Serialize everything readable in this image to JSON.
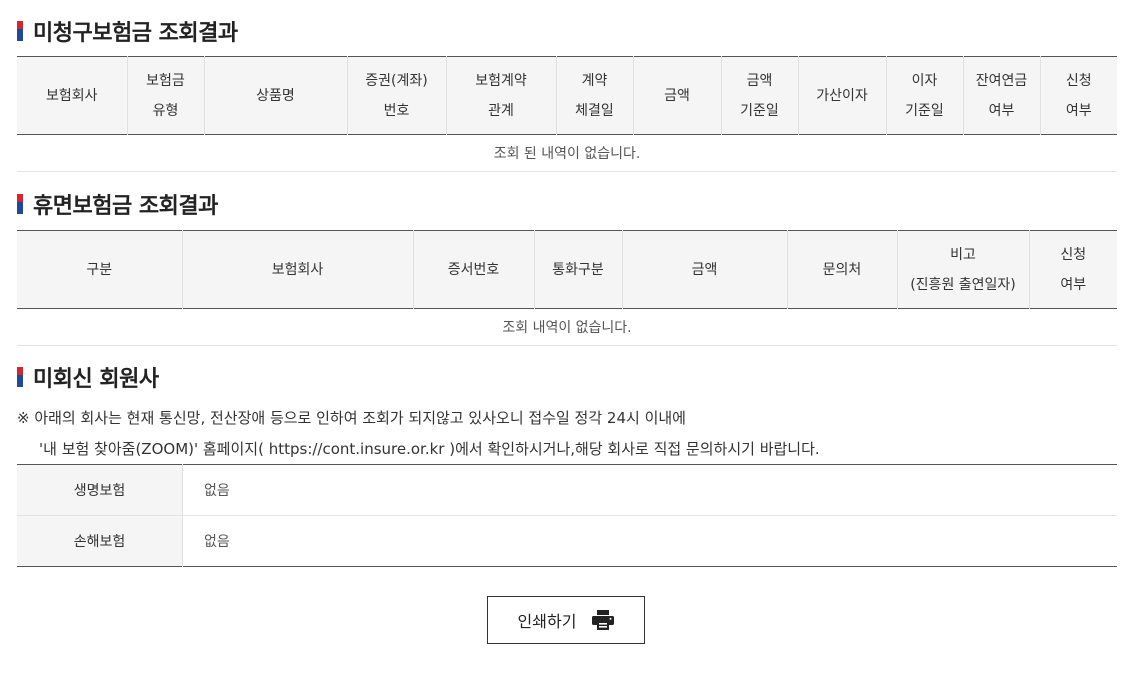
{
  "unclaimed": {
    "title": "미청구보험금 조회결과",
    "headers": [
      [
        "보험회사"
      ],
      [
        "보험금",
        "유형"
      ],
      [
        "상품명"
      ],
      [
        "증권(계좌)",
        "번호"
      ],
      [
        "보험계약",
        "관계"
      ],
      [
        "계약",
        "체결일"
      ],
      [
        "금액"
      ],
      [
        "금액",
        "기준일"
      ],
      [
        "가산이자"
      ],
      [
        "이자",
        "기준일"
      ],
      [
        "잔여연금",
        "여부"
      ],
      [
        "신청",
        "여부"
      ]
    ],
    "empty_message": "조회 된 내역이 없습니다."
  },
  "dormant": {
    "title": "휴면보험금 조회결과",
    "headers": [
      [
        "구분"
      ],
      [
        "보험회사"
      ],
      [
        "증서번호"
      ],
      [
        "통화구분"
      ],
      [
        "금액"
      ],
      [
        "문의처"
      ],
      [
        "비고",
        "(진흥원 출연일자)"
      ],
      [
        "신청",
        "여부"
      ]
    ],
    "empty_message": "조회 내역이 없습니다."
  },
  "nonresponse": {
    "title": "미회신 회원사",
    "notice_line1": "※ 아래의 회사는 현재 통신망, 전산장애 등으로 인하여 조회가 되지않고 있사오니 접수일 정각 24시 이내에",
    "notice_line2": "'내 보험 찾아줌(ZOOM)' 홈페이지( https://cont.insure.or.kr )에서 확인하시거나,해당 회사로 직접 문의하시기 바랍니다.",
    "rows": [
      {
        "label": "생명보험",
        "value": "없음"
      },
      {
        "label": "손해보험",
        "value": "없음"
      }
    ]
  },
  "print_button": {
    "label": "인쇄하기",
    "icon": "printer-icon"
  }
}
